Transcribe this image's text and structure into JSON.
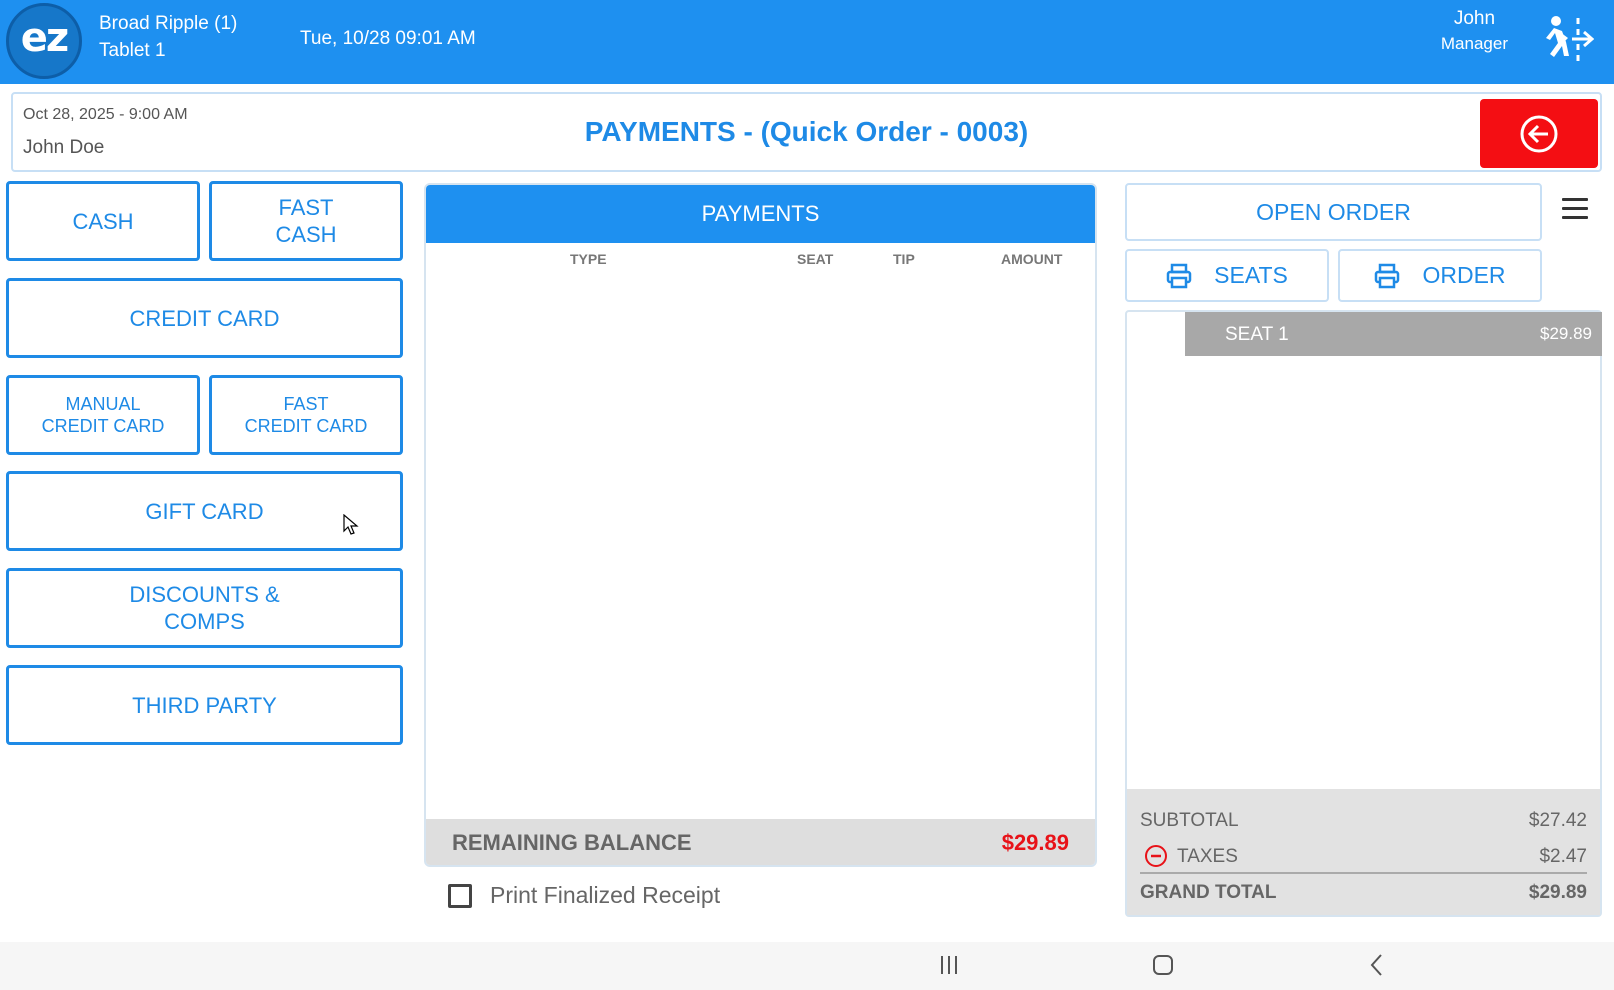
{
  "topbar": {
    "logo_text": "ez",
    "location": "Broad Ripple (1)",
    "device": "Tablet 1",
    "datetime": "Tue, 10/28 09:01 AM",
    "user_name": "John",
    "user_role": "Manager",
    "icons": {
      "logout": "exit-running-person-icon"
    }
  },
  "header": {
    "order_date": "Oct 28, 2025  - 9:00 AM",
    "customer": "John Doe",
    "title": "PAYMENTS - (Quick Order - 0003)",
    "back_icon": "arrow-left-circle-icon"
  },
  "payment_methods": {
    "cash": "CASH",
    "fast_cash_1": "FAST",
    "fast_cash_2": "CASH",
    "credit_card": "CREDIT CARD",
    "manual_cc_1": "MANUAL",
    "manual_cc_2": "CREDIT CARD",
    "fast_cc_1": "FAST",
    "fast_cc_2": "CREDIT CARD",
    "gift_card": "GIFT CARD",
    "discounts_1": "DISCOUNTS &",
    "discounts_2": "COMPS",
    "third_party": "THIRD PARTY"
  },
  "payments": {
    "header": "PAYMENTS",
    "columns": {
      "type": "TYPE",
      "seat": "SEAT",
      "tip": "TIP",
      "amount": "AMOUNT"
    },
    "rows": [],
    "remaining_label": "REMAINING BALANCE",
    "remaining_value": "$29.89"
  },
  "print_receipt": {
    "label": "Print Finalized Receipt",
    "checked": false
  },
  "order": {
    "open_order": "OPEN ORDER",
    "seats": "SEATS",
    "order": "ORDER",
    "menu_icon": "hamburger-menu-icon",
    "print_icon": "printer-icon",
    "seat_name": "SEAT 1",
    "seat_amount": "$29.89",
    "subtotal_label": "SUBTOTAL",
    "subtotal_value": "$27.42",
    "taxes_label": "TAXES",
    "taxes_value": "$2.47",
    "grand_total_label": "GRAND TOTAL",
    "grand_total_value": "$29.89"
  },
  "colors": {
    "brand_blue": "#1e90f0",
    "back_red": "#f40e13",
    "balance_red": "#e81218"
  }
}
